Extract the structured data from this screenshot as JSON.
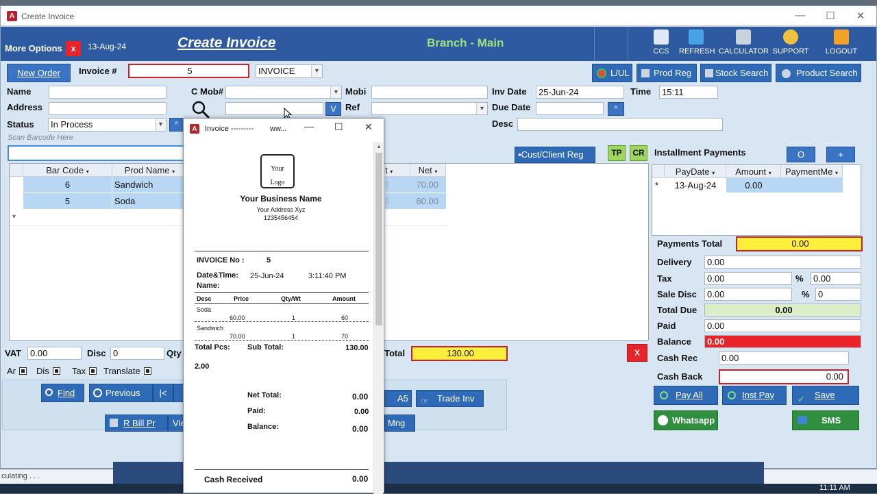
{
  "window": {
    "title": "Create Invoice",
    "app_icon": "A"
  },
  "header": {
    "more_options": "More Options",
    "close_x": "x",
    "date": "13-Aug-24",
    "title": "Create Invoice",
    "branch": "Branch - Main",
    "tools": [
      {
        "label": "CCS",
        "icon": "ccs-icon"
      },
      {
        "label": "REFRESH",
        "icon": "refresh-icon"
      },
      {
        "label": "CALCULATOR",
        "icon": "calculator-icon"
      },
      {
        "label": "SUPPORT",
        "icon": "support-icon"
      },
      {
        "label": "LOGOUT",
        "icon": "logout-icon"
      }
    ]
  },
  "toolbar": {
    "new_order": "New Order",
    "invoice_label": "Invoice #",
    "invoice_value": "5",
    "invoice_type": "INVOICE",
    "lul": "L/UL",
    "prod_reg": "Prod Reg",
    "stock_search": "Stock Search",
    "product_search": "Product Search"
  },
  "form": {
    "name_label": "Name",
    "name_value": "",
    "address_label": "Address",
    "address_value": "",
    "status_label": "Status",
    "status_value": "In Process",
    "cmob_label": "C Mob#",
    "cmob_value": "",
    "mobi_label": "Mobi",
    "mobi_value": "",
    "ref_label": "Ref",
    "ref_value": "",
    "v_btn": "V",
    "up_btn": "^",
    "invdate_label": "Inv Date",
    "invdate_value": "25-Jun-24",
    "time_label": "Time",
    "time_value": "15:11",
    "duedate_label": "Due Date",
    "duedate_value": "",
    "desc_label": "Desc",
    "desc_value": "",
    "scan_placeholder": "Scan Barcode Here",
    "cust_reg": "Cust/Client Reg",
    "tp": "TP",
    "cr": "CR"
  },
  "items_grid": {
    "columns": [
      "Bar Code",
      "Prod Name",
      "t",
      "Net"
    ],
    "rows": [
      {
        "barcode": "6",
        "name": "Sandwich",
        "t": "0",
        "net": "70.00"
      },
      {
        "barcode": "5",
        "name": "Soda",
        "t": "0",
        "net": "60.00"
      }
    ],
    "new_row_marker": "*"
  },
  "installments": {
    "title": "Installment Payments",
    "btn_o": "O",
    "btn_plus": "+",
    "columns": [
      "PayDate",
      "Amount",
      "PaymentMe"
    ],
    "rows": [
      {
        "date": "13-Aug-24",
        "amount": "0.00",
        "method": ""
      }
    ],
    "marker": "*"
  },
  "totals": {
    "payments_total_label": "Payments Total",
    "payments_total": "0.00",
    "delivery_label": "Delivery",
    "delivery": "0.00",
    "tax_label": "Tax",
    "tax": "0.00",
    "tax_pct": "0.00",
    "sale_disc_label": "Sale Disc",
    "sale_disc": "0.00",
    "sale_disc_pct": "0",
    "pct": "%",
    "total_due_label": "Total Due",
    "total_due": "0.00",
    "paid_label": "Paid",
    "paid": "0.00",
    "balance_label": "Balance",
    "balance": "0.00",
    "cash_rec_label": "Cash Rec",
    "cash_rec": "0.00",
    "cash_back_label": "Cash Back",
    "cash_back": "0.00",
    "pay_all": "Pay All",
    "inst_pay": "Inst Pay",
    "save": "Save",
    "whatsapp": "Whatsapp",
    "sms": "SMS"
  },
  "bottom": {
    "vat_label": "VAT",
    "vat": "0.00",
    "disc_label": "Disc",
    "disc": "0",
    "qty_label": "Qty",
    "total_label": "Total",
    "total": "130.00",
    "x": "X",
    "ar": "Ar",
    "dis": "Dis",
    "tax": "Tax",
    "translate": "Translate",
    "find": "Find",
    "previous": "Previous",
    "first": "|<",
    "a5": "A5",
    "trade_inv": "Trade Inv",
    "rbill": "R Bill Pr",
    "vie": "Vie",
    "mng": "Mng"
  },
  "statusbar": {
    "text": "culating . . ."
  },
  "taskbar": {
    "time": "11:11 AM"
  },
  "receipt": {
    "title": "Invoice ---------",
    "title2": "ww...",
    "logo": [
      "Your",
      "Logo"
    ],
    "business": "Your Business Name",
    "address": "Your Address Xyz",
    "phone": "1235456454",
    "invoice_no_label": "INVOICE No :",
    "invoice_no": "5",
    "datetime_label": "Date&Time:",
    "date": "25-Jun-24",
    "time": "3:11:40 PM",
    "name_label": "Name:",
    "cols": [
      "Desc",
      "Price",
      "Qty/Wt",
      "Amount"
    ],
    "items": [
      {
        "desc": "Soda",
        "price": "60.00",
        "qty": "1",
        "amount": "60"
      },
      {
        "desc": "Sandwich",
        "price": "70.00",
        "qty": "1",
        "amount": "70"
      }
    ],
    "total_pcs_label": "Total Pcs:",
    "total_pcs": "2.00",
    "subtotal_label": "Sub Total:",
    "subtotal": "130.00",
    "net_total_label": "Net Total:",
    "net_total": "0.00",
    "paid_label": "Paid:",
    "paid": "0.00",
    "balance_label": "Balance:",
    "balance": "0.00",
    "cash_received_label": "Cash Received",
    "cash_received": "0.00"
  }
}
